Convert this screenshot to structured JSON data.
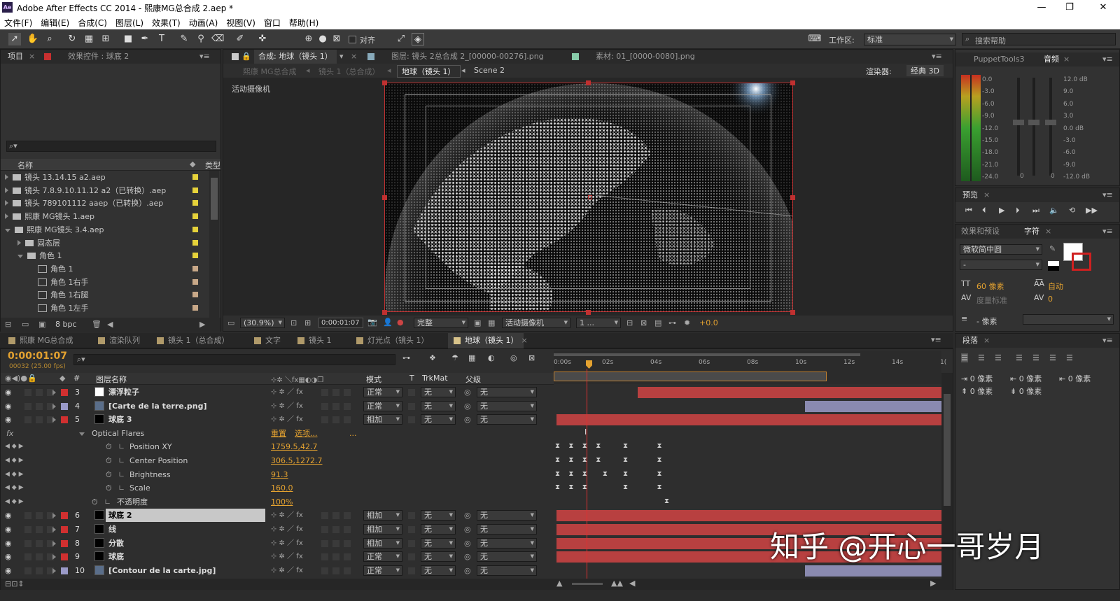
{
  "window": {
    "title": "Adobe After Effects CC 2014 - 熙康MG总合成 2.aep *",
    "logo": "Ae"
  },
  "menu": [
    "文件(F)",
    "编辑(E)",
    "合成(C)",
    "图层(L)",
    "效果(T)",
    "动画(A)",
    "视图(V)",
    "窗口",
    "帮助(H)"
  ],
  "toolbar": {
    "align_label": "对齐",
    "workspace_label": "工作区:",
    "workspace_value": "标准",
    "search_placeholder": "搜索帮助"
  },
  "project_panel": {
    "tab_project": "项目",
    "tab_effects": "效果控件 : 球底 2",
    "col_name": "名称",
    "col_type": "类型",
    "bpc": "8 bpc",
    "items": [
      {
        "label": "镜头 13.14.15 a2.aep",
        "indent": 0,
        "kind": "folder",
        "expander": "closed",
        "color": "#e6d23a"
      },
      {
        "label": "镜头 7.8.9.10.11.12 a2（已转换）.aep",
        "indent": 0,
        "kind": "folder",
        "expander": "closed",
        "color": "#e6d23a"
      },
      {
        "label": "镜头 789101112 aaep（已转换）.aep",
        "indent": 0,
        "kind": "folder",
        "expander": "closed",
        "color": "#e6d23a"
      },
      {
        "label": "熙康 MG镜头 1.aep",
        "indent": 0,
        "kind": "folder",
        "expander": "closed",
        "color": "#e6d23a"
      },
      {
        "label": "熙康 MG镜头 3.4.aep",
        "indent": 0,
        "kind": "folder",
        "expander": "open",
        "color": "#e6d23a"
      },
      {
        "label": "固态层",
        "indent": 1,
        "kind": "folder",
        "expander": "closed",
        "color": "#e6d23a"
      },
      {
        "label": "角色 1",
        "indent": 1,
        "kind": "folder",
        "expander": "open",
        "color": "#e6d23a"
      },
      {
        "label": "角色 1",
        "indent": 2,
        "kind": "comp",
        "expander": "none",
        "color": "#c8a888"
      },
      {
        "label": "角色 1右手",
        "indent": 2,
        "kind": "comp",
        "expander": "none",
        "color": "#c8a888"
      },
      {
        "label": "角色 1右腿",
        "indent": 2,
        "kind": "comp",
        "expander": "none",
        "color": "#c8a888"
      },
      {
        "label": "角色 1左手",
        "indent": 2,
        "kind": "comp",
        "expander": "none",
        "color": "#c8a888"
      }
    ]
  },
  "viewer": {
    "tab_comp": "合成: 地球（镜头 1）",
    "tab_layer": "图层: 镜头 2总合成 2_[00000-00276].png",
    "tab_footage": "素材: 01_[0000-0080].png",
    "breadcrumbs": [
      "熙康 MG总合成",
      "镜头 1（总合成）",
      "地球（镜头 1）",
      "Scene 2"
    ],
    "renderer_label": "渲染器:",
    "renderer_value": "经典 3D",
    "camera_label": "活动摄像机",
    "zoom": "(30.9%)",
    "timecode": "0:00:01:07",
    "quality": "完整",
    "view": "活动摄像机",
    "views_count": "1 ...",
    "exposure": "+0.0"
  },
  "audio_panel": {
    "tab_puppet": "PuppetTools3",
    "tab_audio": "音频",
    "left_scale": [
      "0.0",
      "-3.0",
      "-6.0",
      "-9.0",
      "-12.0",
      "-15.0",
      "-18.0",
      "-21.0",
      "-24.0"
    ],
    "right_scale": [
      "12.0 dB",
      "9.0",
      "6.0",
      "3.0",
      "0.0 dB",
      "-3.0",
      "-6.0",
      "-9.0",
      "-12.0 dB"
    ],
    "slider_zero_left": "0",
    "slider_zero_right": "0"
  },
  "preview_panel": {
    "tab": "预览"
  },
  "char_panel": {
    "tab_effects": "效果和预设",
    "tab_char": "字符",
    "font_name": "微软简中圆",
    "font_style": "-",
    "size_value": "60 像素",
    "leading_value": "自动",
    "kerning_label": "度量标准",
    "tracking_value": "0",
    "stroke_label": "- 像素"
  },
  "para_panel": {
    "tab": "段落",
    "values": [
      "0 像素",
      "0 像素",
      "0 像素",
      "0 像素",
      "0 像素"
    ]
  },
  "timeline": {
    "tabs": [
      "熙康 MG总合成",
      "渲染队列",
      "镜头 1（总合成）",
      "文字",
      "镜头 1",
      "灯光点（镜头 1）",
      "地球（镜头 1）"
    ],
    "active_tab": "地球（镜头 1）",
    "timecode": "0:00:01:07",
    "frame_info": "00032 (25.00 fps)",
    "search_placeholder": "",
    "col_hash": "#",
    "col_layer_name": "图层名称",
    "col_mode": "模式",
    "col_t": "T",
    "col_trkmat": "TrkMat",
    "col_parent": "父级",
    "ruler": [
      "0:00s",
      "02s",
      "04s",
      "06s",
      "08s",
      "10s",
      "12s",
      "14s",
      "1("
    ],
    "layers": [
      {
        "num": "3",
        "name": "漂浮粒子",
        "mode": "正常",
        "trk": "无",
        "parent": "无",
        "color": "#d03030",
        "thumb": "white",
        "bold": true,
        "bar_start": 0.21,
        "bar_color": "#b84040"
      },
      {
        "num": "4",
        "name": "[Carte de la terre.png]",
        "mode": "正常",
        "trk": "无",
        "parent": "无",
        "color": "#9a9ac8",
        "thumb": "img",
        "bold": true,
        "bar_start": 0.64,
        "bar_color": "#8a8ab0"
      },
      {
        "num": "5",
        "name": "球底 3",
        "mode": "相加",
        "trk": "无",
        "parent": "无",
        "color": "#d03030",
        "thumb": "black",
        "bold": true,
        "bar_start": 0.0,
        "bar_color": "#b84040"
      }
    ],
    "effect": {
      "name": "Optical Flares",
      "reset": "重置",
      "options": "选项...",
      "dots": "...",
      "props": [
        {
          "name": "Position XY",
          "value": "1759.5,42.7"
        },
        {
          "name": "Center Position",
          "value": "306.5,1272.7"
        },
        {
          "name": "Brightness",
          "value": "91.3"
        },
        {
          "name": "Scale",
          "value": "160.0"
        }
      ],
      "opacity_name": "不透明度",
      "opacity_value": "100%"
    },
    "layers2": [
      {
        "num": "6",
        "name": "球底 2",
        "mode": "相加",
        "trk": "无",
        "parent": "无",
        "color": "#d03030",
        "thumb": "black",
        "selected": true,
        "bar_start": 0.0,
        "bar_color": "#b84040"
      },
      {
        "num": "7",
        "name": "线",
        "mode": "相加",
        "trk": "无",
        "parent": "无",
        "color": "#d03030",
        "thumb": "black",
        "bar_start": 0.0,
        "bar_color": "#b84040"
      },
      {
        "num": "8",
        "name": "分散",
        "mode": "相加",
        "trk": "无",
        "parent": "无",
        "color": "#d03030",
        "thumb": "black",
        "bar_start": 0.0,
        "bar_color": "#b84040"
      },
      {
        "num": "9",
        "name": "球底",
        "mode": "正常",
        "trk": "无",
        "parent": "无",
        "color": "#d03030",
        "thumb": "black",
        "bar_start": 0.0,
        "bar_color": "#b84040"
      },
      {
        "num": "10",
        "name": "[Contour de la carte.jpg]",
        "mode": "正常",
        "trk": "无",
        "parent": "无",
        "color": "#9a9ac8",
        "thumb": "img",
        "bar_start": 0.64,
        "bar_color": "#8a8ab0"
      }
    ]
  },
  "watermark": "知乎 @开心一哥岁月",
  "colors": {
    "accent_orange": "#e4a230",
    "playhead": "#e03030"
  }
}
